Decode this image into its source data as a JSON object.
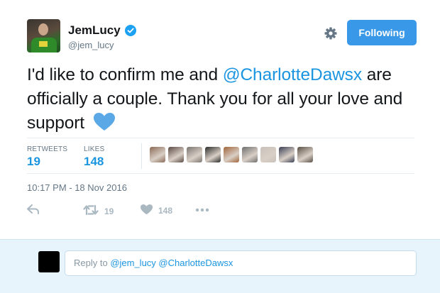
{
  "author": {
    "name": "JemLucy",
    "handle": "@jem_lucy",
    "verified": true
  },
  "header": {
    "follow_label": "Following"
  },
  "tweet": {
    "text_part1": "I'd like to confirm me and ",
    "mention": "@CharlotteDawsx",
    "text_part2": " are officially a couple. Thank you for all your love and support",
    "emoji": "blue-heart-icon"
  },
  "stats": {
    "retweets_label": "RETWEETS",
    "retweets_count": "19",
    "likes_label": "LIKES",
    "likes_count": "148"
  },
  "likers": {
    "colors": [
      "#8a6a55",
      "#5b4a44",
      "#7a7570",
      "#2b2b2b",
      "#a0643a",
      "#6e6e6e",
      "#c8c2bb",
      "#3a3f55",
      "#5a4f45"
    ]
  },
  "timestamp": "10:17 PM - 18 Nov 2016",
  "actions": {
    "retweet_count": "19",
    "like_count": "148"
  },
  "reply": {
    "prefix": "Reply to ",
    "mentions": "@jem_lucy @CharlotteDawsx"
  },
  "colors": {
    "accent": "#1b95e0",
    "button": "#3a98e8",
    "reply_bg": "#e8f4fb"
  }
}
